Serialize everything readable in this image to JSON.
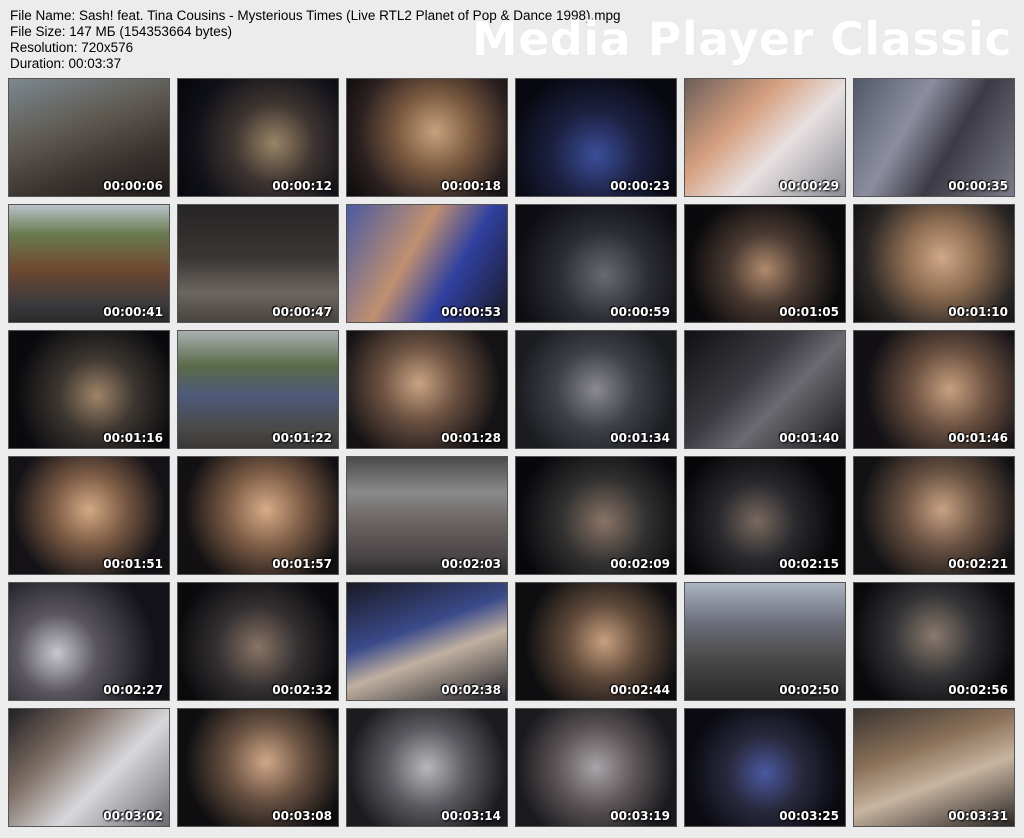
{
  "info": {
    "file_name": "File Name: Sash! feat. Tina Cousins - Mysterious Times (Live RTL2 Planet of Pop & Dance 1998).mpg",
    "file_size": "File Size: 147 МБ (154353664 bytes)",
    "resolution": "Resolution: 720x576",
    "duration": "Duration: 00:03:37"
  },
  "watermark": "Media Player Classic",
  "thumbnails": [
    {
      "time": "00:00:06",
      "bg": "linear-gradient(160deg,#7d8890 0%,#5e5a52 40%,#3a3330 70%,#201c1a 100%)"
    },
    {
      "time": "00:00:12",
      "bg": "radial-gradient(circle at 60% 55%,#9a8466 0%,#3d3430 35%,#101018 70%,#05050a 100%)"
    },
    {
      "time": "00:00:18",
      "bg": "radial-gradient(circle at 55% 45%,#c7a27c 0%,#7a5a40 35%,#2a2020 70%,#0a0808 100%)"
    },
    {
      "time": "00:00:23",
      "bg": "radial-gradient(circle at 50% 65%,#3a4e9a 0%,#1c2040 40%,#080810 80%)"
    },
    {
      "time": "00:00:29",
      "bg": "linear-gradient(135deg,#6b5e58 0%,#d6a080 35%,#e8e0e0 60%,#8a8c96 100%)"
    },
    {
      "time": "00:00:35",
      "bg": "linear-gradient(120deg,#51586a 0%,#8c8ea0 35%,#3c3a44 60%,#7a7c88 100%)"
    },
    {
      "time": "00:00:41",
      "bg": "linear-gradient(180deg,#b8c2c8 0%,#6a7a50 25%,#6e4830 55%,#3a3a3c 85%,#2a2a2a 100%)"
    },
    {
      "time": "00:00:47",
      "bg": "linear-gradient(180deg,#262424 0%,#3a3634 45%,#6c6660 75%,#4a4440 100%)"
    },
    {
      "time": "00:00:53",
      "bg": "linear-gradient(120deg,#4a5aa0 0%,#c09070 40%,#3040a0 65%,#1a1a24 100%)"
    },
    {
      "time": "00:00:59",
      "bg": "radial-gradient(circle at 55% 60%,#6a6a72 0%,#2c2c34 40%,#0c0c12 80%)"
    },
    {
      "time": "00:01:05",
      "bg": "radial-gradient(circle at 50% 55%,#b08a6c 0%,#4a3a32 35%,#0a0a0c 75%)"
    },
    {
      "time": "00:01:10",
      "bg": "radial-gradient(circle at 55% 45%,#d0a888 0%,#8a6a50 35%,#2a2624 70%,#0c0c0c 100%)"
    },
    {
      "time": "00:01:16",
      "bg": "radial-gradient(circle at 55% 55%,#a08468 0%,#3c3630 35%,#0a0a0e 75%)"
    },
    {
      "time": "00:01:22",
      "bg": "linear-gradient(180deg,#a8b0b0 0%,#5a6a48 30%,#4e5a7a 55%,#4a4846 85%,#3a3836 100%)"
    },
    {
      "time": "00:01:28",
      "bg": "radial-gradient(circle at 45% 45%,#caa484 0%,#6a5040 35%,#141214 75%)"
    },
    {
      "time": "00:01:34",
      "bg": "radial-gradient(circle at 50% 50%,#8a8a90 0%,#3e4048 40%,#1a1c20 80%)"
    },
    {
      "time": "00:01:40",
      "bg": "linear-gradient(135deg,#101014 0%,#3a3a40 40%,#6a6a70 60%,#18181c 100%)"
    },
    {
      "time": "00:01:46",
      "bg": "radial-gradient(circle at 60% 50%,#c8a080 0%,#6a5040 35%,#121014 75%)"
    },
    {
      "time": "00:01:51",
      "bg": "radial-gradient(circle at 50% 45%,#d4aa84 0%,#7a5a44 35%,#141216 75%)"
    },
    {
      "time": "00:01:57",
      "bg": "radial-gradient(circle at 55% 45%,#d8ac88 0%,#7c5c46 35%,#121012 75%)"
    },
    {
      "time": "00:02:03",
      "bg": "linear-gradient(180deg,#4a4a4a 0%,#8a8a8c 30%,#6c6462 55%,#4a4446 85%,#2a2a2a 100%)"
    },
    {
      "time": "00:02:09",
      "bg": "radial-gradient(circle at 55% 55%,#8a7466 0%,#303030 40%,#08080c 80%)"
    },
    {
      "time": "00:02:15",
      "bg": "radial-gradient(circle at 45% 55%,#7a6a60 0%,#2a2a2e 35%,#060608 75%)"
    },
    {
      "time": "00:02:21",
      "bg": "radial-gradient(circle at 55% 45%,#c8a284 0%,#6a5242 35%,#121214 75%)"
    },
    {
      "time": "00:02:27",
      "bg": "radial-gradient(circle at 30% 60%,#c8c8d0 0%,#5a5660 30%,#121218 75%)"
    },
    {
      "time": "00:02:32",
      "bg": "radial-gradient(circle at 50% 55%,#8a7464 0%,#343032 40%,#0a0a0c 80%)"
    },
    {
      "time": "00:02:38",
      "bg": "linear-gradient(160deg,#1a1a24 0%,#3a4a8a 40%,#c0b0a0 60%,#202028 100%)"
    },
    {
      "time": "00:02:44",
      "bg": "radial-gradient(circle at 55% 50%,#c8a080 0%,#604a3a 35%,#0e0e10 75%)"
    },
    {
      "time": "00:02:50",
      "bg": "linear-gradient(180deg,#aab4c0 0%,#6a6c78 35%,#4a4848 65%,#2a2a2c 100%)"
    },
    {
      "time": "00:02:56",
      "bg": "radial-gradient(circle at 50% 45%,#8a7a6e 0%,#343436 40%,#0a0a0c 80%)"
    },
    {
      "time": "00:03:02",
      "bg": "linear-gradient(135deg,#202024 0%,#7a6a60 30%,#d8d8dc 60%,#6a6a70 100%)"
    },
    {
      "time": "00:03:08",
      "bg": "radial-gradient(circle at 55% 45%,#d0a888 0%,#6a5242 35%,#0e0e10 75%)"
    },
    {
      "time": "00:03:14",
      "bg": "radial-gradient(circle at 50% 50%,#b8b8bc 0%,#5a5a60 40%,#1c1c20 80%)"
    },
    {
      "time": "00:03:19",
      "bg": "radial-gradient(circle at 50% 50%,#a8a4a8 0%,#5c5456 40%,#1a1a1e 80%)"
    },
    {
      "time": "00:03:25",
      "bg": "radial-gradient(circle at 50% 55%,#4a5aa0 0%,#2a2a40 35%,#0a0a10 75%)"
    },
    {
      "time": "00:03:31",
      "bg": "linear-gradient(160deg,#3a3430 0%,#8a7058 35%,#c8b4a0 60%,#2a2624 100%)"
    }
  ]
}
